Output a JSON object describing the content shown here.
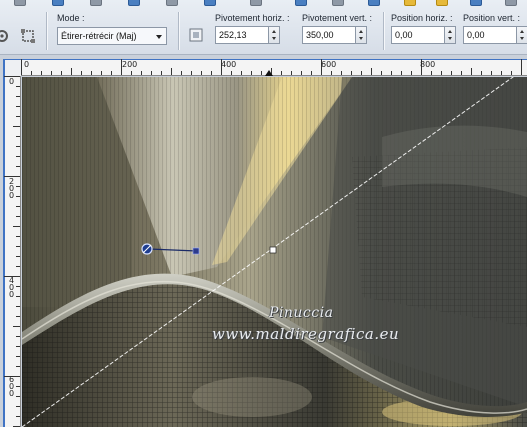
{
  "toolbar": {
    "mode_label": "Mode :",
    "mode_value": "Étirer-rétrécir (Maj)",
    "pivot_h_label": "Pivotement horiz. :",
    "pivot_h_value": "252,13",
    "pivot_v_label": "Pivotement vert. :",
    "pivot_v_value": "350,00",
    "pos_h_label": "Position horiz. :",
    "pos_h_value": "0,00",
    "pos_v_label": "Position vert. :",
    "pos_v_value": "0,00"
  },
  "ruler": {
    "top_labels": [
      "0",
      "200",
      "400",
      "600",
      "800"
    ],
    "left_labels": [
      "0",
      "2\n0\n0",
      "4\n0\n0",
      "6\n0\n0"
    ]
  },
  "watermark": {
    "name": "Pinuccia",
    "site": "www.maldiregrafica.eu"
  },
  "colors": {
    "accent_blue": "#3f73c4",
    "toolbar_bg": "#dde3ec",
    "image_dark": "#2e2c22",
    "image_gold": "#e3d08a"
  },
  "icons": {
    "pick_tool": "pick-tool-icon",
    "rotate_icon": "rotate-icon",
    "stretch_icon": "stretch-icon",
    "pivot_handle": "pivot-handle-icon"
  }
}
